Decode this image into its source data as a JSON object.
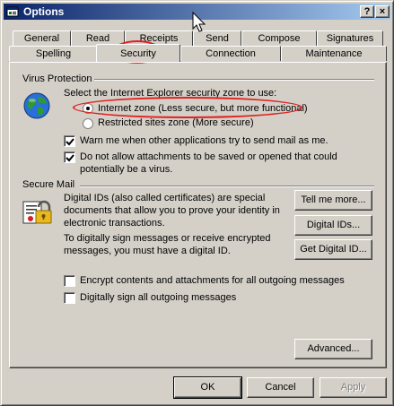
{
  "window": {
    "title": "Options",
    "help_glyph": "?",
    "close_glyph": "×"
  },
  "tabs_row1": [
    "General",
    "Read",
    "Receipts",
    "Send",
    "Compose",
    "Signatures"
  ],
  "tabs_row2": [
    "Spelling",
    "Security",
    "Connection",
    "Maintenance"
  ],
  "selected_tab": "Security",
  "virus_protection": {
    "heading": "Virus Protection",
    "zone_prompt": "Select the Internet Explorer security zone to use:",
    "zone_internet": "Internet zone (Less secure, but more functional)",
    "zone_restricted": "Restricted sites zone (More secure)",
    "selected_zone": "internet",
    "warn_label": "Warn me when other applications try to send mail as me.",
    "warn_checked": true,
    "block_label_line1": "Do not allow attachments to be saved or opened that could",
    "block_label_line2": "potentially be a virus.",
    "block_checked": true
  },
  "secure_mail": {
    "heading": "Secure Mail",
    "desc1_line1": "Digital IDs (also called certificates) are special",
    "desc1_line2": "documents that allow you to prove your identity in",
    "desc1_line3": "electronic transactions.",
    "desc2_line1": "To digitally sign messages or receive encrypted",
    "desc2_line2": "messages, you must have a digital ID.",
    "tell_me_more": "Tell me more...",
    "digital_ids": "Digital IDs...",
    "get_digital_id": "Get Digital ID...",
    "encrypt_label": "Encrypt contents and attachments for all outgoing messages",
    "encrypt_checked": false,
    "sign_label": "Digitally sign all outgoing messages",
    "sign_checked": false
  },
  "advanced_button": "Advanced...",
  "footer": {
    "ok": "OK",
    "cancel": "Cancel",
    "apply": "Apply"
  }
}
